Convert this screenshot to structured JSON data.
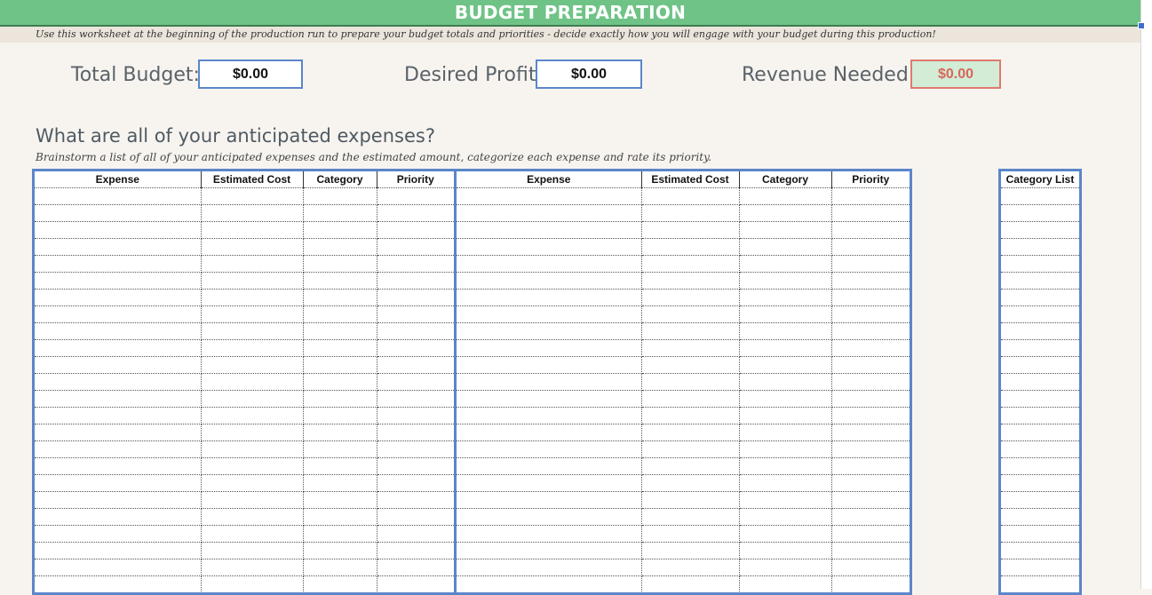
{
  "header": {
    "title": "BUDGET PREPARATION",
    "instruction": "Use this worksheet at the beginning of the production run to prepare your budget totals and priorities - decide exactly how you will engage with your budget during this production!"
  },
  "summary": {
    "total_budget_label": "Total Budget:",
    "total_budget_value": "$0.00",
    "desired_profit_label": "Desired Profit:",
    "desired_profit_value": "$0.00",
    "revenue_needed_label": "Revenue Needed:",
    "revenue_needed_value": "$0.00"
  },
  "expenses": {
    "heading": "What are all of your anticipated expenses?",
    "subheading": "Brainstorm a list of all of your anticipated expenses and the estimated amount, categorize each expense and rate its priority.",
    "left_columns": [
      "Expense",
      "Estimated Cost",
      "Category",
      "Priority"
    ],
    "right_columns": [
      "Expense",
      "Estimated Cost",
      "Category",
      "Priority"
    ],
    "category_list_header": "Category List"
  },
  "colors": {
    "title_bar": "#6fc386",
    "box_border": "#5b86c9",
    "revenue_border": "#e07a6e",
    "revenue_fill": "#d2ecd6"
  }
}
